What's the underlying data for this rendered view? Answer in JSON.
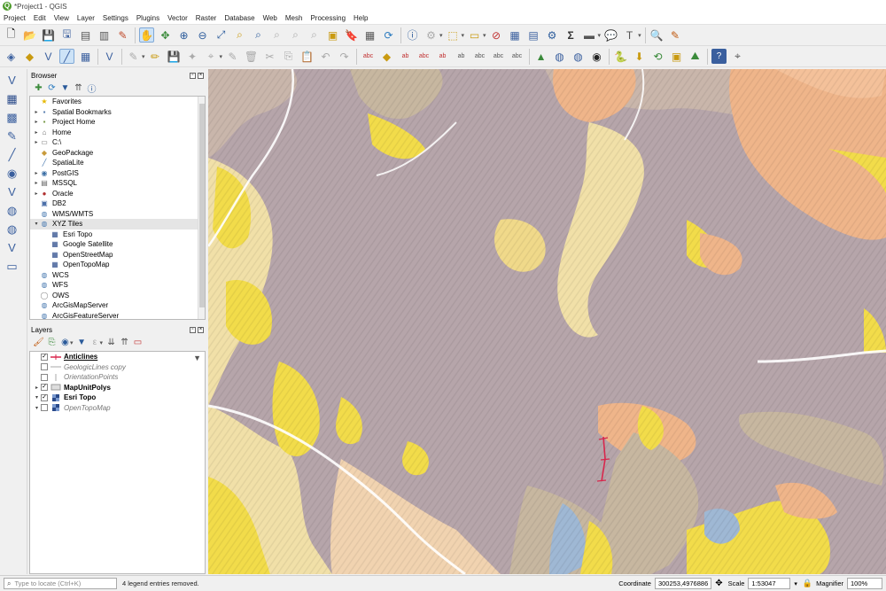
{
  "window": {
    "title": "*Project1 - QGIS",
    "logo_letter": "Q"
  },
  "menu": [
    "Project",
    "Edit",
    "View",
    "Layer",
    "Settings",
    "Plugins",
    "Vector",
    "Raster",
    "Database",
    "Web",
    "Mesh",
    "Processing",
    "Help"
  ],
  "browser": {
    "title": "Browser",
    "items": [
      {
        "label": "Favorites",
        "icon": "★",
        "icon_color": "#e6b800",
        "arrow": "",
        "indent": 0
      },
      {
        "label": "Spatial Bookmarks",
        "icon": "▪",
        "icon_color": "#5a7fb0",
        "arrow": "▸",
        "indent": 0
      },
      {
        "label": "Project Home",
        "icon": "▪",
        "icon_color": "#7a9a4a",
        "arrow": "▸",
        "indent": 0
      },
      {
        "label": "Home",
        "icon": "⌂",
        "icon_color": "#666",
        "arrow": "▸",
        "indent": 0
      },
      {
        "label": "C:\\",
        "icon": "▭",
        "icon_color": "#777",
        "arrow": "▸",
        "indent": 0
      },
      {
        "label": "GeoPackage",
        "icon": "◆",
        "icon_color": "#c89b3c",
        "arrow": "",
        "indent": 0
      },
      {
        "label": "SpatiaLite",
        "icon": "╱",
        "icon_color": "#4a7ab0",
        "arrow": "",
        "indent": 0
      },
      {
        "label": "PostGIS",
        "icon": "◉",
        "icon_color": "#3b6ea5",
        "arrow": "▸",
        "indent": 0
      },
      {
        "label": "MSSQL",
        "icon": "▤",
        "icon_color": "#666",
        "arrow": "▸",
        "indent": 0
      },
      {
        "label": "Oracle",
        "icon": "●",
        "icon_color": "#b03030",
        "arrow": "▸",
        "indent": 0
      },
      {
        "label": "DB2",
        "icon": "▣",
        "icon_color": "#4a6ea8",
        "arrow": "",
        "indent": 0
      },
      {
        "label": "WMS/WMTS",
        "icon": "◍",
        "icon_color": "#4a7ab0",
        "arrow": "",
        "indent": 0
      },
      {
        "label": "XYZ Tiles",
        "icon": "◍",
        "icon_color": "#4a7ab0",
        "arrow": "▾",
        "indent": 0,
        "highlight": true
      },
      {
        "label": "Esri Topo",
        "icon": "▦",
        "icon_color": "#2a4a8a",
        "arrow": "",
        "indent": 1
      },
      {
        "label": "Google Satellite",
        "icon": "▦",
        "icon_color": "#2a4a8a",
        "arrow": "",
        "indent": 1
      },
      {
        "label": "OpenStreetMap",
        "icon": "▦",
        "icon_color": "#2a4a8a",
        "arrow": "",
        "indent": 1
      },
      {
        "label": "OpenTopoMap",
        "icon": "▦",
        "icon_color": "#2a4a8a",
        "arrow": "",
        "indent": 1
      },
      {
        "label": "WCS",
        "icon": "◍",
        "icon_color": "#4a7ab0",
        "arrow": "",
        "indent": 0
      },
      {
        "label": "WFS",
        "icon": "◍",
        "icon_color": "#4a7ab0",
        "arrow": "",
        "indent": 0
      },
      {
        "label": "OWS",
        "icon": "◯",
        "icon_color": "#888",
        "arrow": "",
        "indent": 0
      },
      {
        "label": "ArcGisMapServer",
        "icon": "◍",
        "icon_color": "#4a7ab0",
        "arrow": "",
        "indent": 0
      },
      {
        "label": "ArcGisFeatureServer",
        "icon": "◍",
        "icon_color": "#4a7ab0",
        "arrow": "",
        "indent": 0
      }
    ]
  },
  "layers": {
    "title": "Layers",
    "items": [
      {
        "label": "Anticlines",
        "checked": true,
        "style": "bold-underline",
        "symbol": "line-red",
        "arrow": ""
      },
      {
        "label": "GeologicLines copy",
        "checked": false,
        "style": "italic",
        "symbol": "line-grey",
        "arrow": ""
      },
      {
        "label": "OrientationPoints",
        "checked": false,
        "style": "italic",
        "symbol": "pt-grey",
        "arrow": ""
      },
      {
        "label": "MapUnitPolys",
        "checked": true,
        "style": "bold",
        "symbol": "poly",
        "arrow": "▸"
      },
      {
        "label": "Esri Topo",
        "checked": true,
        "style": "bold",
        "symbol": "raster",
        "arrow": "▾"
      },
      {
        "label": "OpenTopoMap",
        "checked": false,
        "style": "italic",
        "symbol": "raster",
        "arrow": "▾"
      }
    ]
  },
  "status": {
    "locator_placeholder": "Type to locate (Ctrl+K)",
    "message": "4 legend entries removed.",
    "coordinate_label": "Coordinate",
    "coordinate_value": "300253,4976886",
    "scale_label": "Scale",
    "scale_value": "1:53047",
    "magnifier_label": "Magnifier",
    "magnifier_value": "100%"
  },
  "colors": {
    "purple_unit": "#b6a5aa",
    "yellow_unit": "#f2dc4a",
    "cream_unit": "#f1e0a8",
    "orange_unit": "#efb58a",
    "tan_unit": "#c7b7a0",
    "blue_unit": "#9fb8d4",
    "anticline": "#d8264c"
  }
}
